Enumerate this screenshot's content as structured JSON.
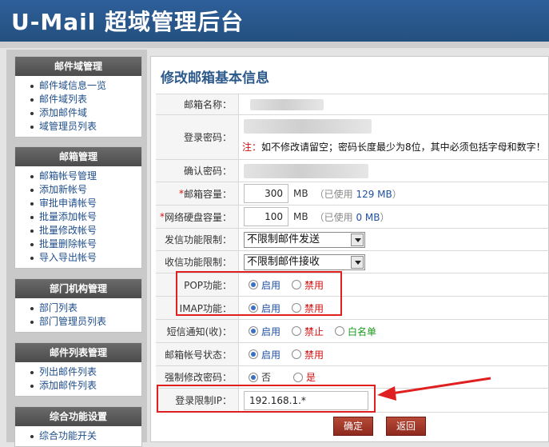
{
  "header": {
    "title": "U-Mail 超域管理后台"
  },
  "sidebar": {
    "sections": [
      {
        "title": "邮件域管理",
        "items": [
          "邮件域信息一览",
          "邮件域列表",
          "添加邮件域",
          "域管理员列表"
        ]
      },
      {
        "title": "邮箱管理",
        "items": [
          "邮箱帐号管理",
          "添加新帐号",
          "审批申请帐号",
          "批量添加帐号",
          "批量修改帐号",
          "批量删除帐号",
          "导入导出帐号"
        ]
      },
      {
        "title": "部门机构管理",
        "items": [
          "部门列表",
          "部门管理员列表"
        ]
      },
      {
        "title": "邮件列表管理",
        "items": [
          "列出邮件列表",
          "添加邮件列表"
        ]
      },
      {
        "title": "综合功能设置",
        "items": [
          "综合功能开关"
        ]
      }
    ]
  },
  "main": {
    "title": "修改邮箱基本信息",
    "fields": {
      "mailbox_name": {
        "label": "邮箱名称："
      },
      "password": {
        "label": "登录密码：",
        "note_prefix": "注：",
        "note_text": "如不修改请留空；密码长度最少为8位，其中必须包括字母和数字！"
      },
      "confirm_password": {
        "label": "确认密码："
      },
      "mailbox_capacity": {
        "label": "邮箱容量：",
        "value": "300",
        "unit": "MB",
        "used_prefix": "（已使用",
        "used_value": "129 MB",
        "used_suffix": "）"
      },
      "netdisk_capacity": {
        "label": "网络硬盘容量：",
        "value": "100",
        "unit": "MB",
        "used_prefix": "（已使用",
        "used_value": "0 MB",
        "used_suffix": "）"
      },
      "send_limit": {
        "label": "发信功能限制：",
        "selected": "不限制邮件发送"
      },
      "receive_limit": {
        "label": "收信功能限制：",
        "selected": "不限制邮件接收"
      },
      "pop": {
        "label": "POP功能：",
        "on": "启用",
        "off": "禁用",
        "selected": "启用"
      },
      "imap": {
        "label": "IMAP功能：",
        "on": "启用",
        "off": "禁用",
        "selected": "启用"
      },
      "sms_notify": {
        "label": "短信通知(收)：",
        "on": "启用",
        "off": "禁止",
        "whitelist": "白名单",
        "selected": "启用"
      },
      "account_status": {
        "label": "邮箱帐号状态：",
        "on": "启用",
        "off": "禁用",
        "selected": "启用"
      },
      "force_pw_change": {
        "label": "强制修改密码：",
        "no": "否",
        "yes": "是",
        "selected": "否"
      },
      "login_ip_limit": {
        "label": "登录限制IP：",
        "value": "192.168.1.*"
      }
    },
    "buttons": {
      "confirm": "确定",
      "back": "返回"
    }
  },
  "colors": {
    "header_bg": "#2f5f9a",
    "accent_red": "#e02020",
    "link_blue": "#1f4e8a"
  }
}
